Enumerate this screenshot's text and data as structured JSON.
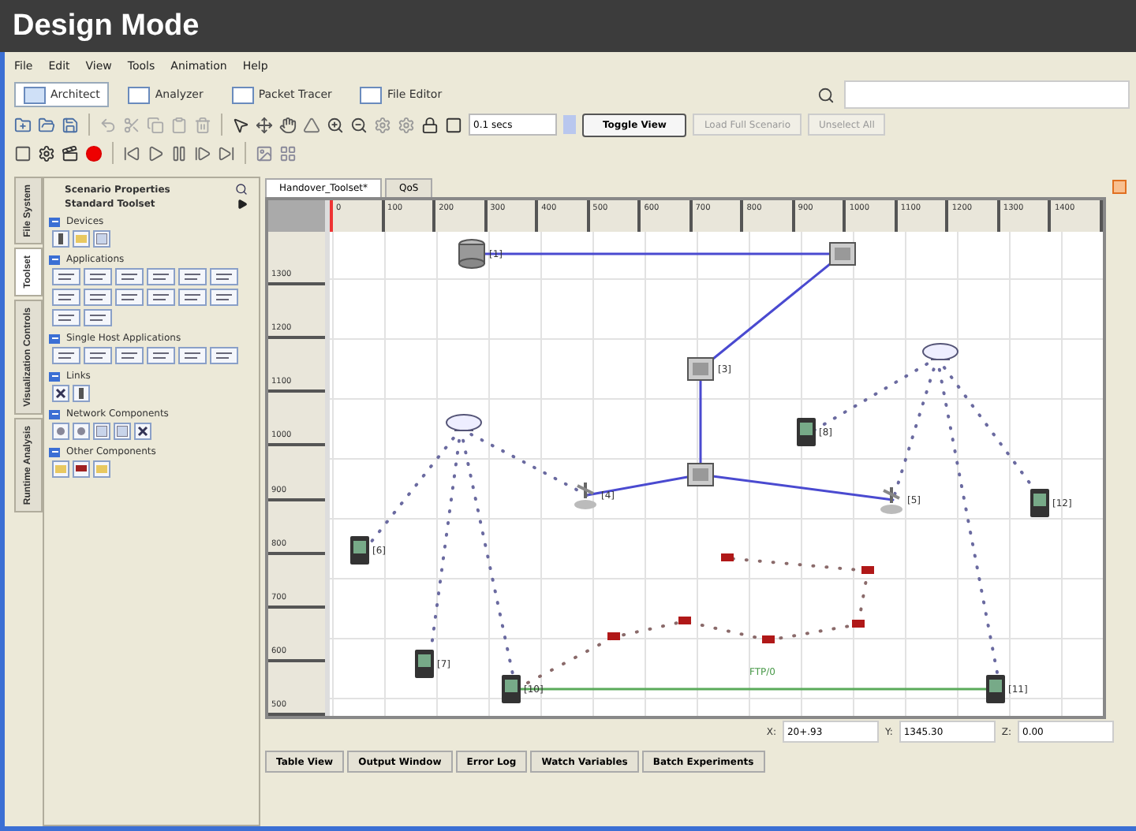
{
  "header": {
    "title": "Design Mode"
  },
  "menu": [
    "File",
    "Edit",
    "View",
    "Tools",
    "Animation",
    "Help"
  ],
  "modes": [
    {
      "label": "Architect",
      "selected": true
    },
    {
      "label": "Analyzer",
      "selected": false
    },
    {
      "label": "Packet Tracer",
      "selected": false
    },
    {
      "label": "File Editor",
      "selected": false
    }
  ],
  "toolbar": {
    "time_field": {
      "value": "0.1 secs"
    },
    "toggle_button": "Toggle View",
    "dropdowns": [
      {
        "label": "Load Full Scenario",
        "disabled": true
      },
      {
        "label": "Unselect All",
        "disabled": true
      }
    ]
  },
  "side_tabs": [
    {
      "label": "File System",
      "selected": false
    },
    {
      "label": "Toolset",
      "selected": true
    },
    {
      "label": "Visualization Controls",
      "selected": false
    },
    {
      "label": "Runtime Analysis",
      "selected": false
    }
  ],
  "sidebar": {
    "scenario_properties": "Scenario Properties",
    "toolset": "Standard Toolset",
    "groups": [
      {
        "title": "Devices",
        "expanded": true,
        "tools": [
          {
            "kind": "device"
          },
          {
            "kind": "folder"
          },
          {
            "kind": "grid"
          }
        ]
      },
      {
        "title": "Applications",
        "expanded": true,
        "tools": [
          {
            "kind": "app"
          },
          {
            "kind": "app"
          },
          {
            "kind": "app"
          },
          {
            "kind": "app"
          },
          {
            "kind": "app"
          },
          {
            "kind": "app"
          },
          {
            "kind": "app"
          },
          {
            "kind": "app"
          },
          {
            "kind": "app"
          },
          {
            "kind": "app"
          },
          {
            "kind": "app"
          },
          {
            "kind": "app"
          },
          {
            "kind": "app"
          },
          {
            "kind": "app"
          }
        ]
      },
      {
        "title": "Single Host Applications",
        "expanded": true,
        "tools": [
          {
            "kind": "app"
          },
          {
            "kind": "app"
          },
          {
            "kind": "app"
          },
          {
            "kind": "app"
          },
          {
            "kind": "app"
          },
          {
            "kind": "app"
          }
        ]
      },
      {
        "title": "Links",
        "expanded": true,
        "tools": [
          {
            "kind": "link"
          },
          {
            "kind": "device"
          }
        ]
      },
      {
        "title": "Network Components",
        "expanded": true,
        "tools": [
          {
            "kind": "network"
          },
          {
            "kind": "network"
          },
          {
            "kind": "grid"
          },
          {
            "kind": "grid"
          },
          {
            "kind": "link"
          }
        ]
      },
      {
        "title": "Other Components",
        "expanded": true,
        "tools": [
          {
            "kind": "folder"
          },
          {
            "kind": "flag"
          },
          {
            "kind": "folder"
          }
        ]
      }
    ]
  },
  "canvas": {
    "tabs": [
      {
        "label": "Handover_Toolset*",
        "selected": true
      },
      {
        "label": "QoS",
        "selected": false
      }
    ],
    "x_ruler": [
      "0",
      "100",
      "200",
      "300",
      "400",
      "500",
      "600",
      "700",
      "800",
      "900",
      "1000",
      "1100",
      "1200",
      "1300",
      "1400"
    ],
    "y_ruler": [
      "1300",
      "1200",
      "1100",
      "1000",
      "900",
      "800",
      "700",
      "600",
      "500"
    ],
    "nodes": [
      {
        "kind": "server",
        "label": "[1]"
      },
      {
        "kind": "router"
      },
      {
        "kind": "router",
        "label": "[3]"
      },
      {
        "kind": "router"
      },
      {
        "kind": "access-point"
      },
      {
        "kind": "access-point"
      },
      {
        "kind": "antenna",
        "label": "[4]"
      },
      {
        "kind": "antenna",
        "label": "[5]"
      },
      {
        "kind": "phone",
        "label": "[8]"
      },
      {
        "kind": "phone",
        "label": "[6]"
      },
      {
        "kind": "phone",
        "label": "[12]"
      },
      {
        "kind": "phone",
        "label": "[7]"
      },
      {
        "kind": "phone",
        "label": "[10]"
      },
      {
        "kind": "phone",
        "label": "[11]"
      }
    ],
    "link_label": "FTP/0",
    "coordinates": [
      {
        "axis": "X:",
        "value": "20+.93"
      },
      {
        "axis": "Y:",
        "value": "1345.30"
      },
      {
        "axis": "Z:",
        "value": "0.00"
      }
    ]
  },
  "bottom_tabs": [
    {
      "label": "Table View",
      "selected": false
    },
    {
      "label": "Output Window",
      "selected": false
    },
    {
      "label": "Error Log",
      "selected": false
    },
    {
      "label": "Watch Variables",
      "selected": false
    },
    {
      "label": "Batch Experiments",
      "selected": false
    }
  ]
}
